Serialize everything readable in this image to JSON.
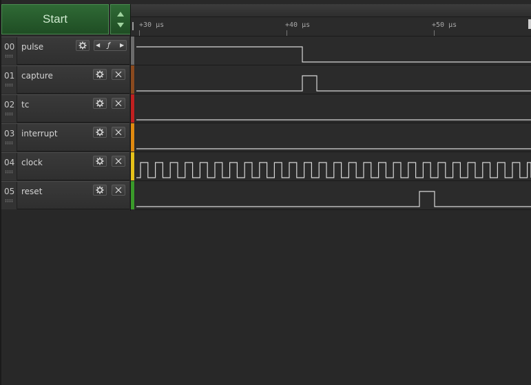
{
  "start": {
    "label": "Start"
  },
  "timeline": {
    "ticks": [
      {
        "label": "+30 µs"
      },
      {
        "label": "+40 µs"
      },
      {
        "label": "+50 µs"
      }
    ]
  },
  "channels": [
    {
      "num": "00",
      "name": "pulse",
      "color": "#6b6b6b",
      "trigger": "ƒ"
    },
    {
      "num": "01",
      "name": "capture",
      "color": "#8a4a1f"
    },
    {
      "num": "02",
      "name": "tc",
      "color": "#c02020"
    },
    {
      "num": "03",
      "name": "interrupt",
      "color": "#e08a10"
    },
    {
      "num": "04",
      "name": "clock",
      "color": "#e6c21a"
    },
    {
      "num": "05",
      "name": "reset",
      "color": "#3a9a2a"
    }
  ],
  "icons": {
    "settings": "gear-icon",
    "close": "close-icon",
    "prev": "triangle-left-icon",
    "next": "triangle-right-icon",
    "trigger": "falling-edge-trigger-icon",
    "sort_up": "triangle-up-icon",
    "sort_down": "triangle-down-icon"
  }
}
